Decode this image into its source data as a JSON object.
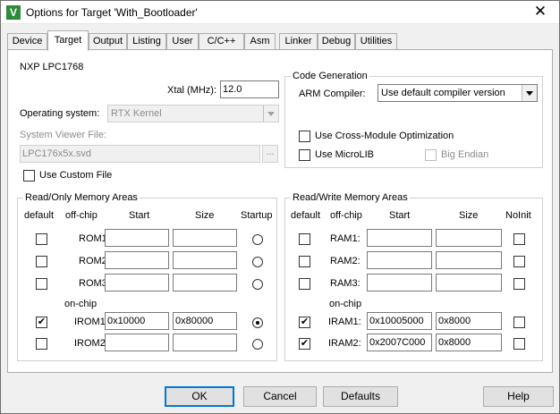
{
  "window": {
    "title": "Options for Target 'With_Bootloader'",
    "icon": "uvision-icon",
    "close": "✕"
  },
  "tabs": [
    {
      "label": "Device",
      "active": false
    },
    {
      "label": "Target",
      "active": true
    },
    {
      "label": "Output",
      "active": false
    },
    {
      "label": "Listing",
      "active": false
    },
    {
      "label": "User",
      "active": false
    },
    {
      "label": "C/C++",
      "active": false
    },
    {
      "label": "Asm",
      "active": false
    },
    {
      "label": "Linker",
      "active": false
    },
    {
      "label": "Debug",
      "active": false
    },
    {
      "label": "Utilities",
      "active": false
    }
  ],
  "target": {
    "device_name": "NXP LPC1768",
    "xtal_label": "Xtal (MHz):",
    "xtal_value": "12.0",
    "os_label": "Operating system:",
    "os_value": "RTX Kernel",
    "svd_label": "System Viewer File:",
    "svd_value": "LPC176x5x.svd",
    "browse_label": "...",
    "custom_file_label": "Use Custom File",
    "custom_file_checked": false
  },
  "codegen": {
    "title": "Code Generation",
    "compiler_label": "ARM Compiler:",
    "compiler_value": "Use default compiler version",
    "cross_module_label": "Use Cross-Module Optimization",
    "cross_module_checked": false,
    "microlib_label": "Use MicroLIB",
    "microlib_checked": false,
    "big_endian_label": "Big Endian",
    "big_endian_checked": false
  },
  "rom": {
    "title": "Read/Only Memory Areas",
    "headers": {
      "default": "default",
      "offchip": "off-chip",
      "start": "Start",
      "size": "Size",
      "extra": "Startup"
    },
    "onchip_label": "on-chip",
    "rows": [
      {
        "name": "ROM1:",
        "default": false,
        "start": "",
        "size": "",
        "startup": false
      },
      {
        "name": "ROM2:",
        "default": false,
        "start": "",
        "size": "",
        "startup": false
      },
      {
        "name": "ROM3:",
        "default": false,
        "start": "",
        "size": "",
        "startup": false
      },
      {
        "name": "IROM1:",
        "default": true,
        "start": "0x10000",
        "size": "0x80000",
        "startup": true
      },
      {
        "name": "IROM2:",
        "default": false,
        "start": "",
        "size": "",
        "startup": false
      }
    ]
  },
  "ram": {
    "title": "Read/Write Memory Areas",
    "headers": {
      "default": "default",
      "offchip": "off-chip",
      "start": "Start",
      "size": "Size",
      "extra": "NoInit"
    },
    "onchip_label": "on-chip",
    "rows": [
      {
        "name": "RAM1:",
        "default": false,
        "start": "",
        "size": "",
        "noinit": false
      },
      {
        "name": "RAM2:",
        "default": false,
        "start": "",
        "size": "",
        "noinit": false
      },
      {
        "name": "RAM3:",
        "default": false,
        "start": "",
        "size": "",
        "noinit": false
      },
      {
        "name": "IRAM1:",
        "default": true,
        "start": "0x10005000",
        "size": "0x8000",
        "noinit": false
      },
      {
        "name": "IRAM2:",
        "default": true,
        "start": "0x2007C000",
        "size": "0x8000",
        "noinit": false
      }
    ]
  },
  "buttons": {
    "ok": "OK",
    "cancel": "Cancel",
    "defaults": "Defaults",
    "help": "Help"
  },
  "glyphs": {
    "check": "✔"
  }
}
